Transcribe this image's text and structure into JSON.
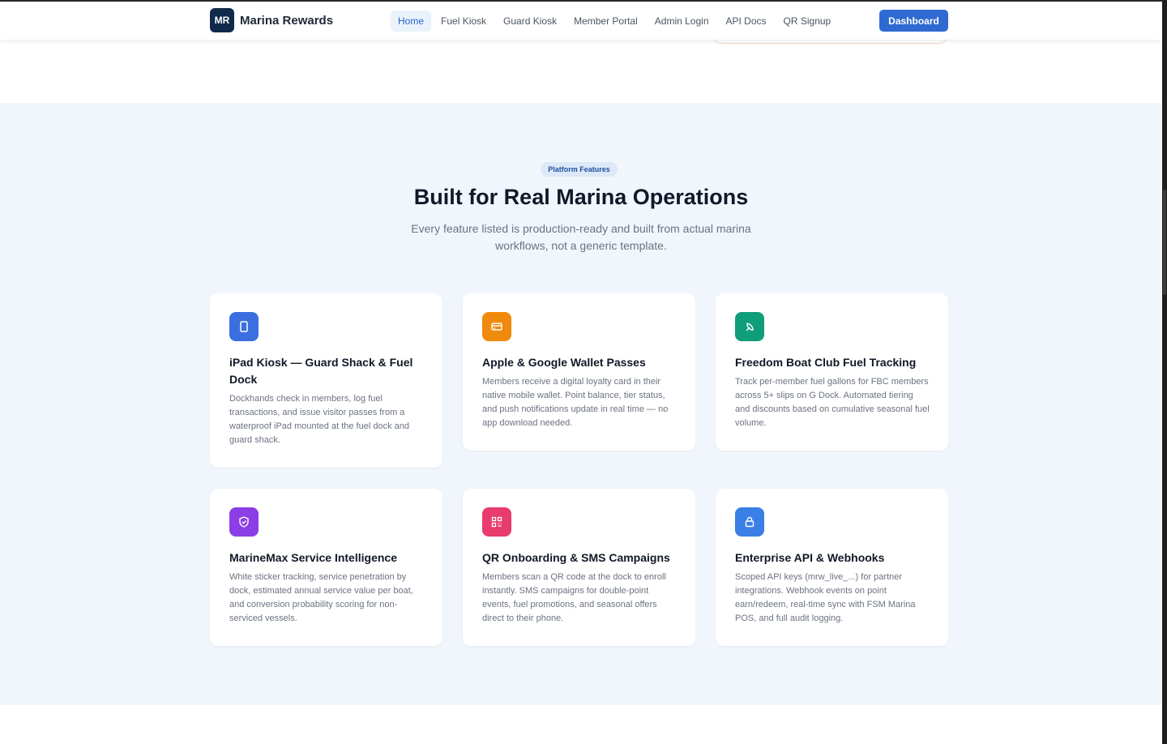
{
  "nav": {
    "logo_text": "MR",
    "brand": "Marina Rewards",
    "links": [
      {
        "label": "Home",
        "active": true
      },
      {
        "label": "Fuel Kiosk"
      },
      {
        "label": "Guard Kiosk"
      },
      {
        "label": "Member Portal"
      },
      {
        "label": "Admin Login"
      },
      {
        "label": "API Docs"
      },
      {
        "label": "QR Signup"
      }
    ],
    "cta": "Dashboard"
  },
  "features": {
    "badge": "Platform Features",
    "title": "Built for Real Marina Operations",
    "subtitle": "Every feature listed is production-ready and built from actual marina workflows, not a generic template.",
    "cards": [
      {
        "icon": "tablet-icon",
        "icon_color": "#3b6fe0",
        "title": "iPad Kiosk — Guard Shack & Fuel Dock",
        "text": "Dockhands check in members, log fuel transactions, and issue visitor passes from a waterproof iPad mounted at the fuel dock and guard shack."
      },
      {
        "icon": "credit-card-icon",
        "icon_color": "#f08a0c",
        "title": "Apple & Google Wallet Passes",
        "text": "Members receive a digital loyalty card in their native mobile wallet. Point balance, tier status, and push notifications update in real time — no app download needed."
      },
      {
        "icon": "fuel-drop-icon",
        "icon_color": "#0f9d7a",
        "title": "Freedom Boat Club Fuel Tracking",
        "text": "Track per-member fuel gallons for FBC members across 5+ slips on G Dock. Automated tiering and discounts based on cumulative seasonal fuel volume."
      },
      {
        "icon": "shield-icon",
        "icon_color": "#8b3ee6",
        "title": "MarineMax Service Intelligence",
        "text": "White sticker tracking, service penetration by dock, estimated annual service value per boat, and conversion probability scoring for non-serviced vessels."
      },
      {
        "icon": "qr-code-icon",
        "icon_color": "#e83c6e",
        "title": "QR Onboarding & SMS Campaigns",
        "text": "Members scan a QR code at the dock to enroll instantly. SMS campaigns for double-point events, fuel promotions, and seasonal offers direct to their phone."
      },
      {
        "icon": "lock-icon",
        "icon_color": "#3a7fe6",
        "title": "Enterprise API & Webhooks",
        "text": "Scoped API keys (mrw_live_...) for partner integrations. Webhook events on point earn/redeem, real-time sync with FSM Marina POS, and full audit logging."
      }
    ]
  }
}
